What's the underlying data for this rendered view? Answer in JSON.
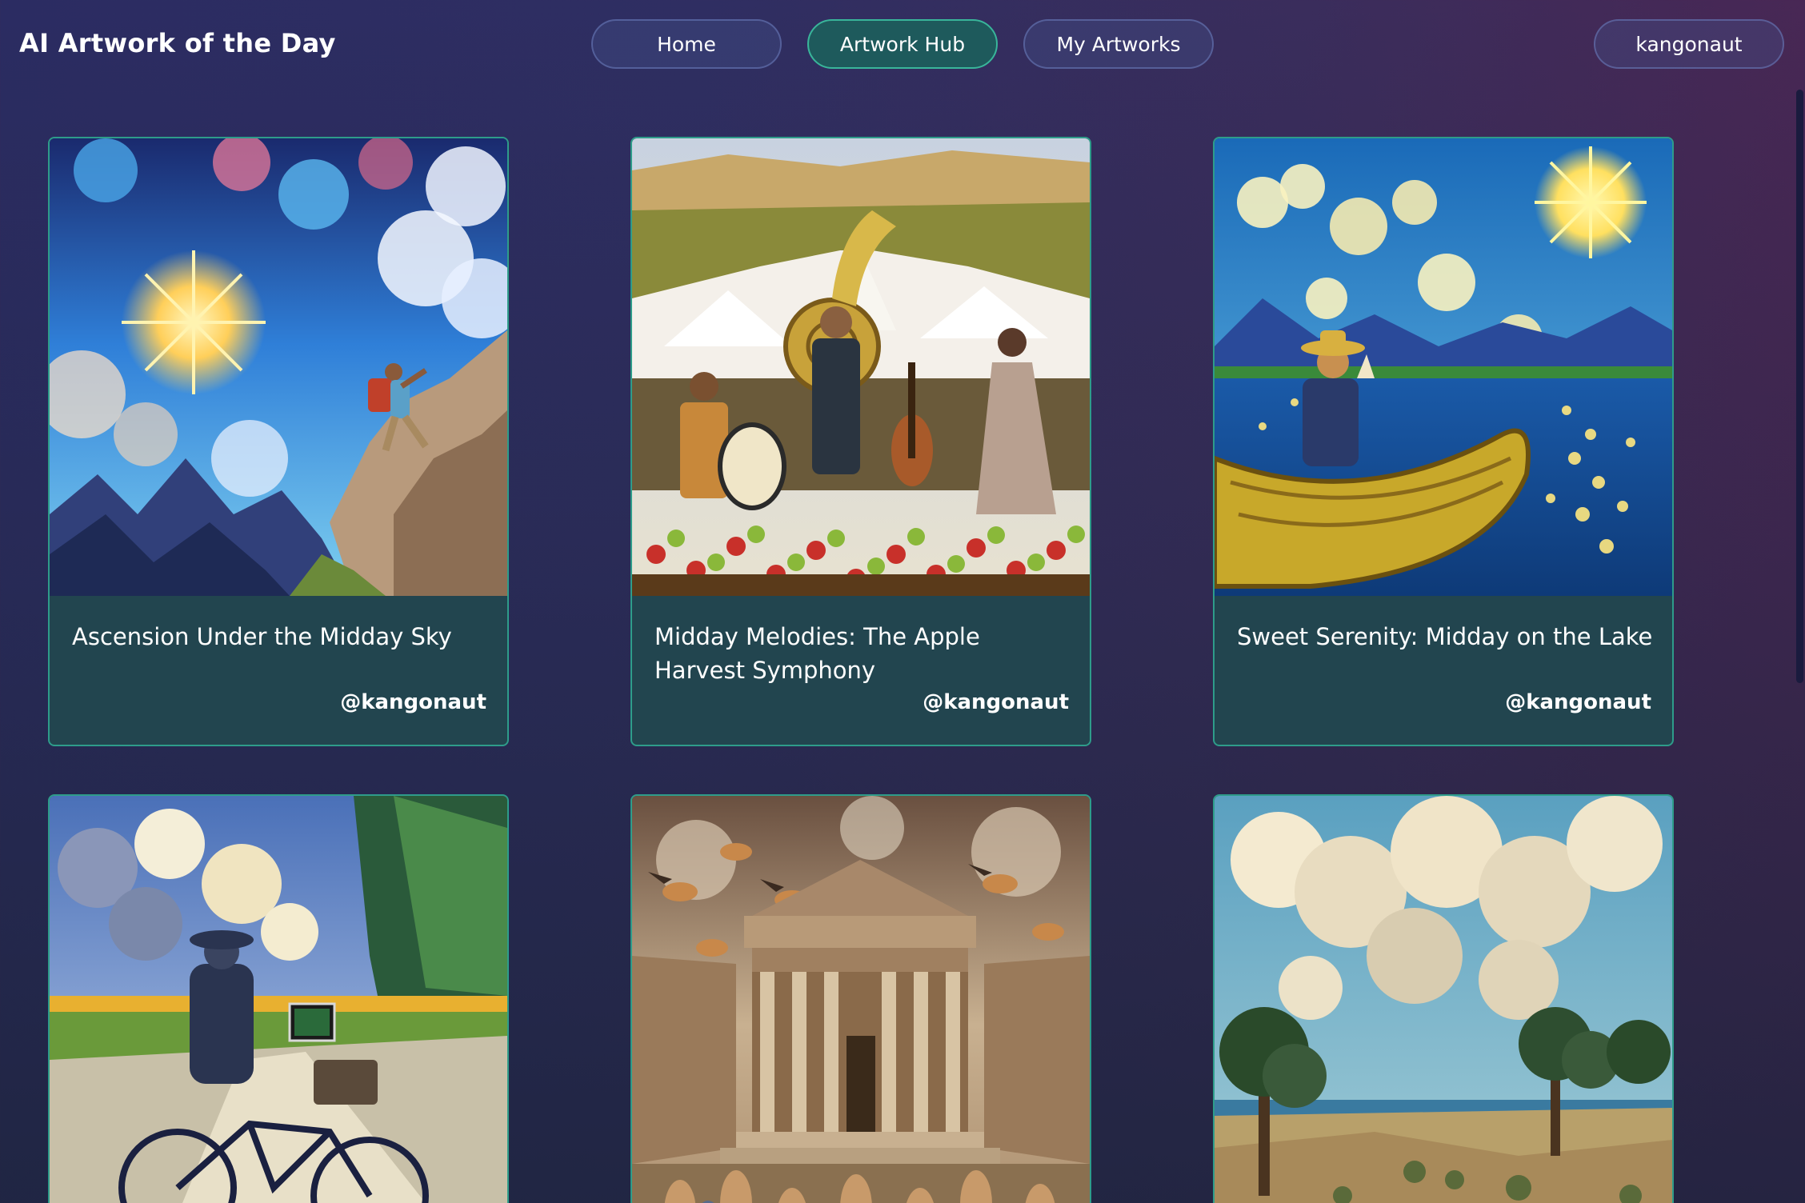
{
  "header": {
    "brand": "AI Artwork of the Day",
    "nav": {
      "home": "Home",
      "artwork_hub": "Artwork Hub",
      "my_artworks": "My Artworks"
    },
    "user": "kangonaut",
    "active_tab": "Artwork Hub"
  },
  "artworks": [
    {
      "title": "Ascension Under the Midday Sky",
      "author": "@kangonaut"
    },
    {
      "title": "Midday Melodies: The Apple Harvest Symphony",
      "author": "@kangonaut"
    },
    {
      "title": "Sweet Serenity: Midday on the Lake",
      "author": "@kangonaut"
    },
    {
      "title": "",
      "author": ""
    },
    {
      "title": "",
      "author": ""
    },
    {
      "title": "",
      "author": ""
    }
  ],
  "colors": {
    "accent": "#2e9c8a",
    "card_bg": "#22454f",
    "active_nav_bg": "#1e5a5c"
  }
}
